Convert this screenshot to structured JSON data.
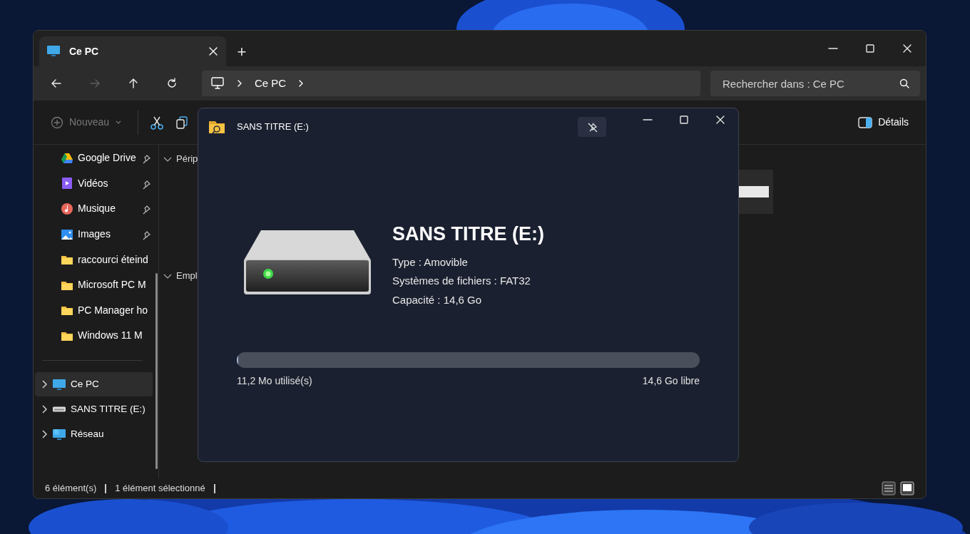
{
  "window": {
    "tab": {
      "title": "Ce PC",
      "selected": true
    },
    "new_tab": "+"
  },
  "nav": {
    "buttons": [
      {
        "kind": "back",
        "disabled": false
      },
      {
        "kind": "forward",
        "disabled": true
      },
      {
        "kind": "up",
        "disabled": false
      },
      {
        "kind": "refresh",
        "disabled": false
      }
    ],
    "breadcrumb": [
      "Ce PC"
    ],
    "search": {
      "placeholder": "Rechercher dans : Ce PC"
    }
  },
  "commands": {
    "new": {
      "label": "Nouveau",
      "disabled": true
    },
    "details": "Détails"
  },
  "sidebar": {
    "quick_access": [
      {
        "kind": "drive",
        "label": "Google Drive",
        "pinned": true
      },
      {
        "kind": "videos",
        "label": "Vidéos",
        "pinned": true
      },
      {
        "kind": "music",
        "label": "Musique",
        "pinned": true
      },
      {
        "kind": "images",
        "label": "Images",
        "pinned": true
      },
      {
        "kind": "folder",
        "label": "raccourci éteind",
        "pinned": false
      },
      {
        "kind": "folder",
        "label": "Microsoft PC M",
        "pinned": false
      },
      {
        "kind": "folder",
        "label": "PC Manager ho",
        "pinned": false
      },
      {
        "kind": "folder",
        "label": "Windows 11 M",
        "pinned": false
      }
    ],
    "tree": [
      {
        "kind": "pc",
        "label": "Ce PC",
        "selected": true
      },
      {
        "kind": "usb",
        "label": "SANS TITRE (E:)",
        "selected": false
      },
      {
        "kind": "network",
        "label": "Réseau",
        "selected": false
      }
    ]
  },
  "content": {
    "groups": [
      "Périp",
      "Empl"
    ]
  },
  "status_bar": {
    "count": "6 élément(s)",
    "selection": "1 élément sélectionné",
    "views": [
      {
        "kind": "details",
        "selected": false
      },
      {
        "kind": "tiles",
        "selected": true
      }
    ]
  },
  "dialog": {
    "title": "SANS TITRE (E:)",
    "drive_name": "SANS TITRE (E:)",
    "info": [
      "Type : Amovible",
      "Systèmes de fichiers : FAT32",
      "Capacité : 14,6 Go"
    ],
    "usage": {
      "level": 0.003,
      "used": "11,2 Mo utilisé(s)",
      "free": "14,6 Go libre"
    }
  }
}
